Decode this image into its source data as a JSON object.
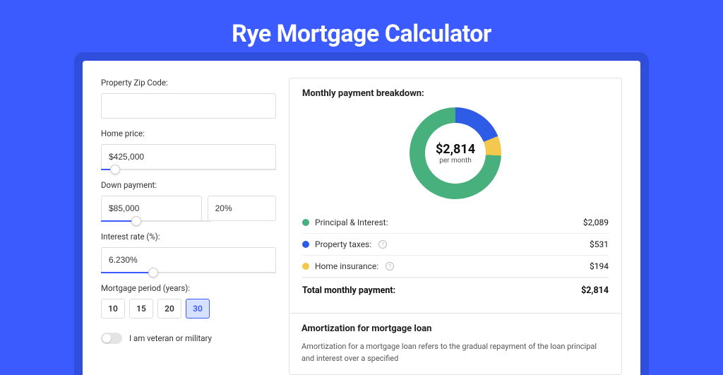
{
  "title": "Rye Mortgage Calculator",
  "form": {
    "zip_label": "Property Zip Code:",
    "zip_value": "",
    "home_price_label": "Home price:",
    "home_price_value": "$425,000",
    "home_price_slider_pct": 8,
    "down_payment_label": "Down payment:",
    "down_payment_amount": "$85,000",
    "down_payment_pct": "20%",
    "down_payment_slider_pct": 20,
    "interest_label": "Interest rate (%):",
    "interest_value": "6.230%",
    "interest_slider_pct": 30,
    "period_label": "Mortgage period (years):",
    "period_options": [
      "10",
      "15",
      "20",
      "30"
    ],
    "period_selected": "30",
    "veteran_label": "I am veteran or military",
    "veteran_on": false
  },
  "breakdown": {
    "title": "Monthly payment breakdown:",
    "total": "$2,814",
    "per_month": "per month",
    "items": [
      {
        "label": "Principal & Interest:",
        "value": "$2,089",
        "color": "green",
        "info": false
      },
      {
        "label": "Property taxes:",
        "value": "$531",
        "color": "blue",
        "info": true
      },
      {
        "label": "Home insurance:",
        "value": "$194",
        "color": "yellow",
        "info": true
      }
    ],
    "total_label": "Total monthly payment:",
    "total_value": "$2,814"
  },
  "amortization": {
    "title": "Amortization for mortgage loan",
    "text": "Amortization for a mortgage loan refers to the gradual repayment of the loan principal and interest over a specified"
  },
  "chart_data": {
    "type": "pie",
    "title": "Monthly payment breakdown",
    "series": [
      {
        "name": "Principal & Interest",
        "value": 2089,
        "color": "#48B07D"
      },
      {
        "name": "Property taxes",
        "value": 531,
        "color": "#2F5CE6"
      },
      {
        "name": "Home insurance",
        "value": 194,
        "color": "#F4C84F"
      }
    ],
    "total": 2814,
    "center_label": "$2,814 per month"
  }
}
